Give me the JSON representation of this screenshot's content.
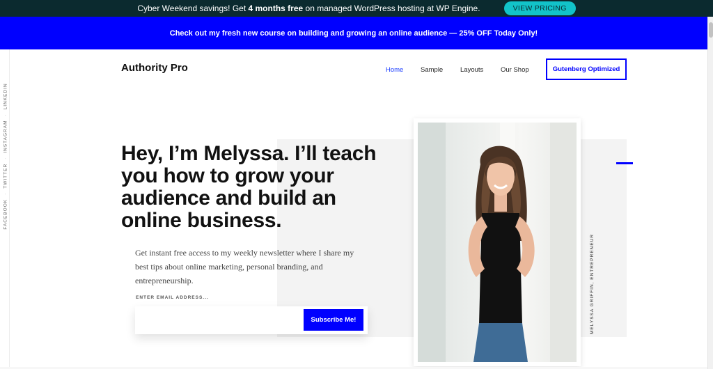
{
  "topbar": {
    "message_prefix": "Cyber Weekend savings! Get ",
    "message_bold": "4 months free",
    "message_suffix": " on managed WordPress hosting at WP Engine.",
    "button_label": "VIEW PRICING"
  },
  "announcement": {
    "text": "Check out my fresh new course on building and growing an online audience — 25% OFF Today Only!"
  },
  "social": {
    "items": [
      "FACEBOOK",
      "TWITTER",
      "INSTAGRAM",
      "LINKEDIN"
    ]
  },
  "header": {
    "logo": "Authority Pro",
    "nav": [
      {
        "label": "Home",
        "active": true
      },
      {
        "label": "Sample",
        "active": false
      },
      {
        "label": "Layouts",
        "active": false
      },
      {
        "label": "Our Shop",
        "active": false
      }
    ],
    "cta_label": "Gutenberg Optimized"
  },
  "hero": {
    "headline": "Hey, I’m Melyssa. I’ll teach you how to grow your audience and build an online business.",
    "intro": "Get instant free access to my weekly newsletter where I share my best tips about online marketing, personal branding, and entrepreneurship.",
    "email_label": "ENTER EMAIL ADDRESS...",
    "email_value": "",
    "email_placeholder": "",
    "subscribe_label": "Subscribe Me!",
    "photo_caption": "MELYSSA GRIFFIN, ENTREPRENEUR"
  },
  "colors": {
    "topbar_bg": "#0b2a2f",
    "pricing_button": "#12c3c9",
    "brand_blue": "#0000ff",
    "panel_gray": "#f3f3f3"
  }
}
